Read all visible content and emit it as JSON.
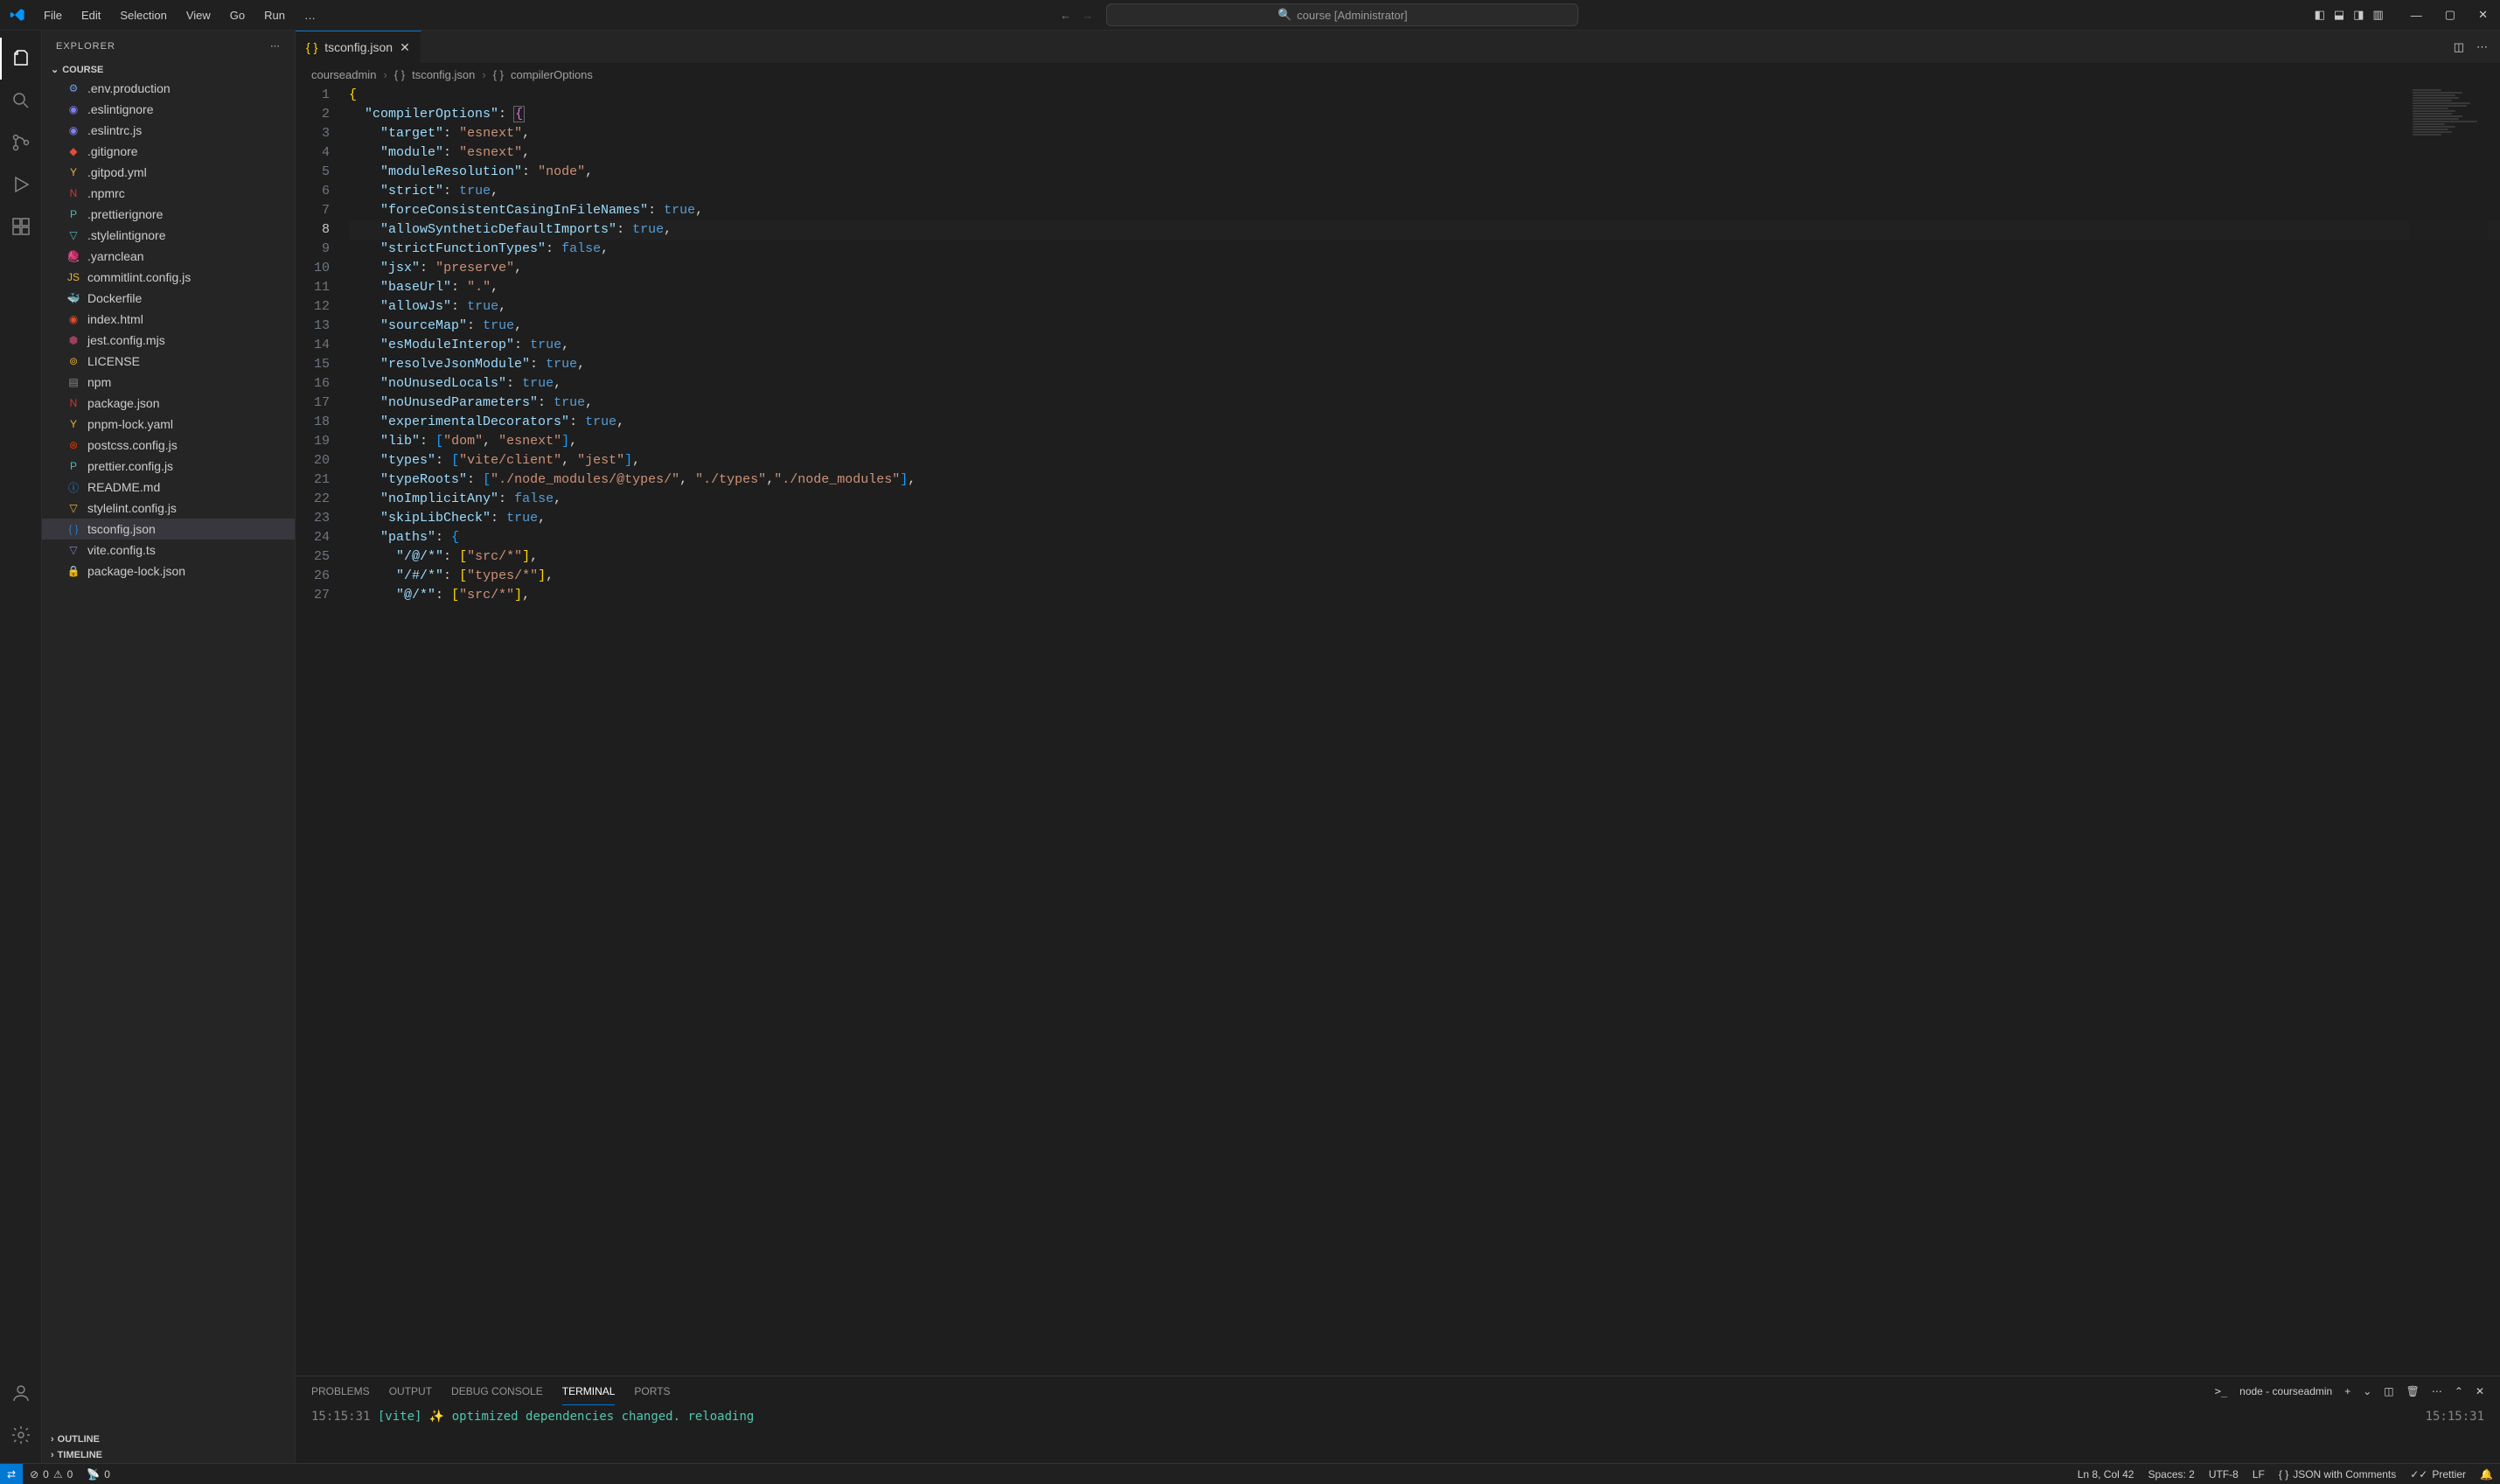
{
  "menu": [
    "File",
    "Edit",
    "Selection",
    "View",
    "Go",
    "Run",
    "…"
  ],
  "search_placeholder": "course [Administrator]",
  "explorer_title": "EXPLORER",
  "folder_name": "COURSE",
  "files": [
    {
      "name": ".env.production",
      "icon": "env",
      "color": "#6d9ee6"
    },
    {
      "name": ".eslintignore",
      "icon": "eslint",
      "color": "#8080f2"
    },
    {
      "name": ".eslintrc.js",
      "icon": "eslint",
      "color": "#8080f2"
    },
    {
      "name": ".gitignore",
      "icon": "git",
      "color": "#e54d3a"
    },
    {
      "name": ".gitpod.yml",
      "icon": "yaml",
      "color": "#e8b339"
    },
    {
      "name": ".npmrc",
      "icon": "npm",
      "color": "#cb3837"
    },
    {
      "name": ".prettierignore",
      "icon": "prettier",
      "color": "#56b3b4"
    },
    {
      "name": ".stylelintignore",
      "icon": "stylelint",
      "color": "#56b3b4"
    },
    {
      "name": ".yarnclean",
      "icon": "yarn",
      "color": "#2c8ebb"
    },
    {
      "name": "commitlint.config.js",
      "icon": "js",
      "color": "#e8b339"
    },
    {
      "name": "Dockerfile",
      "icon": "docker",
      "color": "#2496ed"
    },
    {
      "name": "index.html",
      "icon": "html",
      "color": "#e34c26"
    },
    {
      "name": "jest.config.mjs",
      "icon": "jest",
      "color": "#99425b"
    },
    {
      "name": "LICENSE",
      "icon": "license",
      "color": "#d4a72c"
    },
    {
      "name": "npm",
      "icon": "file",
      "color": "#888"
    },
    {
      "name": "package.json",
      "icon": "npm",
      "color": "#cb3837"
    },
    {
      "name": "pnpm-lock.yaml",
      "icon": "yaml",
      "color": "#e8b339"
    },
    {
      "name": "postcss.config.js",
      "icon": "postcss",
      "color": "#dd3a0a"
    },
    {
      "name": "prettier.config.js",
      "icon": "prettier",
      "color": "#56b3b4"
    },
    {
      "name": "README.md",
      "icon": "info",
      "color": "#2196f3"
    },
    {
      "name": "stylelint.config.js",
      "icon": "stylelint",
      "color": "#e8b339"
    },
    {
      "name": "tsconfig.json",
      "icon": "ts",
      "color": "#3178c6",
      "selected": true
    },
    {
      "name": "vite.config.ts",
      "icon": "vite",
      "color": "#9575cd"
    },
    {
      "name": "package-lock.json",
      "icon": "npmlock",
      "color": "#cb3837"
    }
  ],
  "outline_label": "OUTLINE",
  "timeline_label": "TIMELINE",
  "tab": {
    "name": "tsconfig.json"
  },
  "breadcrumb": [
    "courseadmin",
    "tsconfig.json",
    "compilerOptions"
  ],
  "code_lines": [
    {
      "n": 1,
      "html": "<span class='s-brace'>{</span>"
    },
    {
      "n": 2,
      "html": "  <span class='s-key'>\"compilerOptions\"</span><span class='s-punct'>:</span> <span class='s-brace2 s-hl'>{</span>"
    },
    {
      "n": 3,
      "html": "    <span class='s-key'>\"target\"</span><span class='s-punct'>:</span> <span class='s-str'>\"esnext\"</span><span class='s-punct'>,</span>"
    },
    {
      "n": 4,
      "html": "    <span class='s-key'>\"module\"</span><span class='s-punct'>:</span> <span class='s-str'>\"esnext\"</span><span class='s-punct'>,</span>"
    },
    {
      "n": 5,
      "html": "    <span class='s-key'>\"moduleResolution\"</span><span class='s-punct'>:</span> <span class='s-str'>\"node\"</span><span class='s-punct'>,</span>"
    },
    {
      "n": 6,
      "html": "    <span class='s-key'>\"strict\"</span><span class='s-punct'>:</span> <span class='s-bool'>true</span><span class='s-punct'>,</span>"
    },
    {
      "n": 7,
      "html": "    <span class='s-key'>\"forceConsistentCasingInFileNames\"</span><span class='s-punct'>:</span> <span class='s-bool'>true</span><span class='s-punct'>,</span>"
    },
    {
      "n": 8,
      "html": "    <span class='s-key'>\"allowSyntheticDefaultImports\"</span><span class='s-punct'>:</span> <span class='s-bool'>true</span><span class='s-punct'>,</span>",
      "active": true
    },
    {
      "n": 9,
      "html": "    <span class='s-key'>\"strictFunctionTypes\"</span><span class='s-punct'>:</span> <span class='s-bool'>false</span><span class='s-punct'>,</span>"
    },
    {
      "n": 10,
      "html": "    <span class='s-key'>\"jsx\"</span><span class='s-punct'>:</span> <span class='s-str'>\"preserve\"</span><span class='s-punct'>,</span>"
    },
    {
      "n": 11,
      "html": "    <span class='s-key'>\"baseUrl\"</span><span class='s-punct'>:</span> <span class='s-str'>\".\"</span><span class='s-punct'>,</span>"
    },
    {
      "n": 12,
      "html": "    <span class='s-key'>\"allowJs\"</span><span class='s-punct'>:</span> <span class='s-bool'>true</span><span class='s-punct'>,</span>"
    },
    {
      "n": 13,
      "html": "    <span class='s-key'>\"sourceMap\"</span><span class='s-punct'>:</span> <span class='s-bool'>true</span><span class='s-punct'>,</span>"
    },
    {
      "n": 14,
      "html": "    <span class='s-key'>\"esModuleInterop\"</span><span class='s-punct'>:</span> <span class='s-bool'>true</span><span class='s-punct'>,</span>"
    },
    {
      "n": 15,
      "html": "    <span class='s-key'>\"resolveJsonModule\"</span><span class='s-punct'>:</span> <span class='s-bool'>true</span><span class='s-punct'>,</span>"
    },
    {
      "n": 16,
      "html": "    <span class='s-key'>\"noUnusedLocals\"</span><span class='s-punct'>:</span> <span class='s-bool'>true</span><span class='s-punct'>,</span>"
    },
    {
      "n": 17,
      "html": "    <span class='s-key'>\"noUnusedParameters\"</span><span class='s-punct'>:</span> <span class='s-bool'>true</span><span class='s-punct'>,</span>"
    },
    {
      "n": 18,
      "html": "    <span class='s-key'>\"experimentalDecorators\"</span><span class='s-punct'>:</span> <span class='s-bool'>true</span><span class='s-punct'>,</span>"
    },
    {
      "n": 19,
      "html": "    <span class='s-key'>\"lib\"</span><span class='s-punct'>:</span> <span class='s-brace3'>[</span><span class='s-str'>\"dom\"</span><span class='s-punct'>,</span> <span class='s-str'>\"esnext\"</span><span class='s-brace3'>]</span><span class='s-punct'>,</span>"
    },
    {
      "n": 20,
      "html": "    <span class='s-key'>\"types\"</span><span class='s-punct'>:</span> <span class='s-brace3'>[</span><span class='s-str'>\"vite/client\"</span><span class='s-punct'>,</span> <span class='s-str'>\"jest\"</span><span class='s-brace3'>]</span><span class='s-punct'>,</span>"
    },
    {
      "n": 21,
      "html": "    <span class='s-key'>\"typeRoots\"</span><span class='s-punct'>:</span> <span class='s-brace3'>[</span><span class='s-str'>\"./node_modules/@types/\"</span><span class='s-punct'>,</span> <span class='s-str'>\"./types\"</span><span class='s-punct'>,</span><span class='s-str'>\"./node_modules\"</span><span class='s-brace3'>]</span><span class='s-punct'>,</span>"
    },
    {
      "n": 22,
      "html": "    <span class='s-key'>\"noImplicitAny\"</span><span class='s-punct'>:</span> <span class='s-bool'>false</span><span class='s-punct'>,</span>"
    },
    {
      "n": 23,
      "html": "    <span class='s-key'>\"skipLibCheck\"</span><span class='s-punct'>:</span> <span class='s-bool'>true</span><span class='s-punct'>,</span>"
    },
    {
      "n": 24,
      "html": "    <span class='s-key'>\"paths\"</span><span class='s-punct'>:</span> <span class='s-brace3'>{</span>"
    },
    {
      "n": 25,
      "html": "      <span class='s-key'>\"/@/*\"</span><span class='s-punct'>:</span> <span class='s-brace'>[</span><span class='s-str'>\"src/*\"</span><span class='s-brace'>]</span><span class='s-punct'>,</span>"
    },
    {
      "n": 26,
      "html": "      <span class='s-key'>\"/#/*\"</span><span class='s-punct'>:</span> <span class='s-brace'>[</span><span class='s-str'>\"types/*\"</span><span class='s-brace'>]</span><span class='s-punct'>,</span>"
    },
    {
      "n": 27,
      "html": "      <span class='s-key'>\"@/*\"</span><span class='s-punct'>:</span> <span class='s-brace'>[</span><span class='s-str'>\"src/*\"</span><span class='s-brace'>]</span><span class='s-punct'>,</span>"
    }
  ],
  "panel_tabs": [
    "PROBLEMS",
    "OUTPUT",
    "DEBUG CONSOLE",
    "TERMINAL",
    "PORTS"
  ],
  "panel_active": "TERMINAL",
  "terminal_name": "node - courseadmin",
  "terminal": {
    "time": "15:15:31",
    "tag": "[vite]",
    "msg": "optimized dependencies changed. reloading",
    "time_right": "15:15:31"
  },
  "status": {
    "errors": "0",
    "warnings": "0",
    "ports": "0",
    "cursor": "Ln 8, Col 42",
    "spaces": "Spaces: 2",
    "encoding": "UTF-8",
    "eol": "LF",
    "lang": "JSON with Comments",
    "prettier": "Prettier"
  }
}
